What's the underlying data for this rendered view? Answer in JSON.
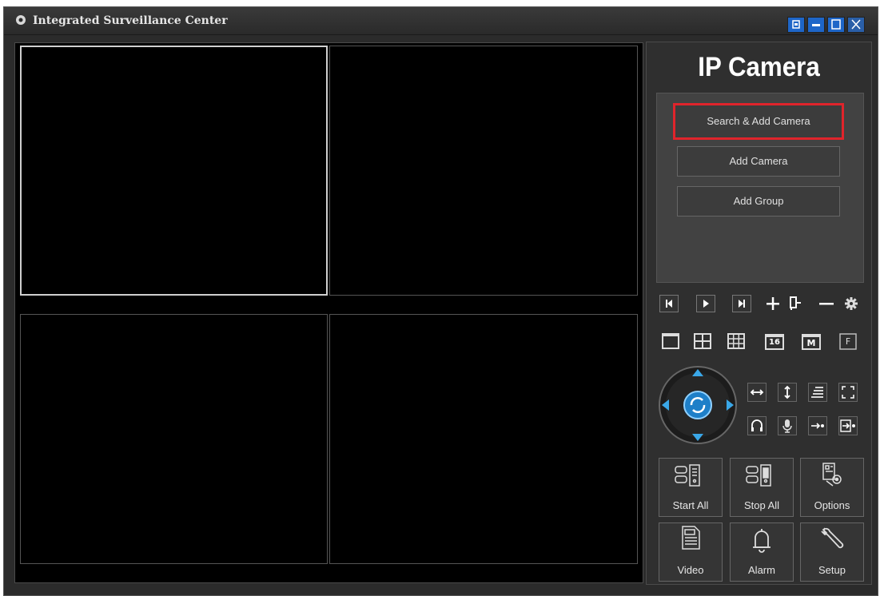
{
  "window": {
    "title": "Integrated Surveillance Center"
  },
  "window_controls": [
    "restore-icon",
    "minimize-icon",
    "maximize-icon",
    "close-icon"
  ],
  "brand": "IP Camera",
  "actions": {
    "search_add": "Search & Add Camera",
    "add_camera": "Add Camera",
    "add_group": "Add Group"
  },
  "playback_toolbar": [
    "first-icon",
    "play-icon",
    "last-icon",
    "plus-icon",
    "snapshot-icon",
    "minus-icon",
    "gear-icon"
  ],
  "layout_buttons": {
    "sixteen": "16",
    "m": "M",
    "f": "F"
  },
  "bottom_buttons": {
    "start_all": "Start All",
    "stop_all": "Stop All",
    "options": "Options",
    "video": "Video",
    "alarm": "Alarm",
    "setup": "Setup"
  },
  "colors": {
    "highlight": "#e0242b",
    "ptz_blue": "#3aa7e8",
    "background": "#2b2b2b"
  }
}
